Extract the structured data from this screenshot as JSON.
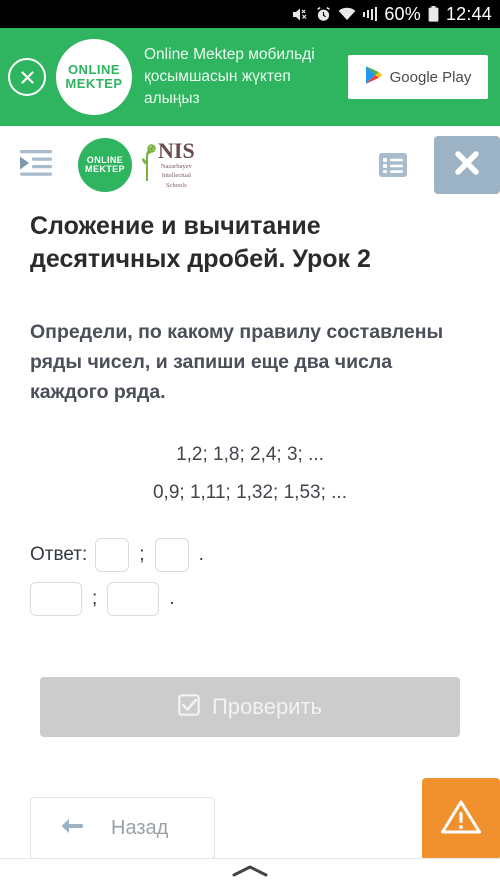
{
  "status_bar": {
    "icons": [
      "mute-icon",
      "alarm-icon",
      "wifi-icon",
      "signal-icon",
      "battery-icon"
    ],
    "battery_percent": "60%",
    "time": "12:44"
  },
  "ad_banner": {
    "close_icon": "close-circle-icon",
    "logo_line1": "ONLINE",
    "logo_line2": "MEKTEP",
    "text": "Online Mektep мобильді қосымшасын жүктеп алыңыз",
    "store_badge_label": "Google Play",
    "store_badge_icon": "google-play-icon",
    "background_color": "#2fb45f"
  },
  "app_header": {
    "menu_icon": "format-indent-icon",
    "logo_om_line1": "ONLINE",
    "logo_om_line2": "MEKTEP",
    "logo_nis_main": "NIS",
    "logo_nis_sub_line1": "Nazarbayev",
    "logo_nis_sub_line2": "Intellectual",
    "logo_nis_sub_line3": "Schools",
    "list_icon": "list-view-icon",
    "close_icon": "close-icon",
    "close_button_color": "#9bb3c4"
  },
  "main": {
    "lesson_title": "Сложение и вычитание десятичных дробей. Урок 2",
    "question": "Определи, по какому правилу составлены ряды чисел, и запиши еще два числа каждого ряда.",
    "sequences": [
      "1,2; 1,8; 2,4; 3; ...",
      "0,9; 1,11; 1,32; 1,53; ..."
    ],
    "answer": {
      "label": "Ответ:",
      "separator": ";",
      "terminator": ".",
      "row1": [
        "",
        ""
      ],
      "row2": [
        "",
        ""
      ]
    },
    "check_button": {
      "label": "Проверить",
      "icon": "checkbox-checked-icon",
      "color": "#cccccc",
      "enabled": false
    }
  },
  "bottom": {
    "back_label": "Назад",
    "back_icon": "arrow-left-icon",
    "warning_icon": "warning-triangle-icon",
    "warning_color": "#f0912d",
    "nav_chevron_icon": "chevron-up-icon"
  }
}
